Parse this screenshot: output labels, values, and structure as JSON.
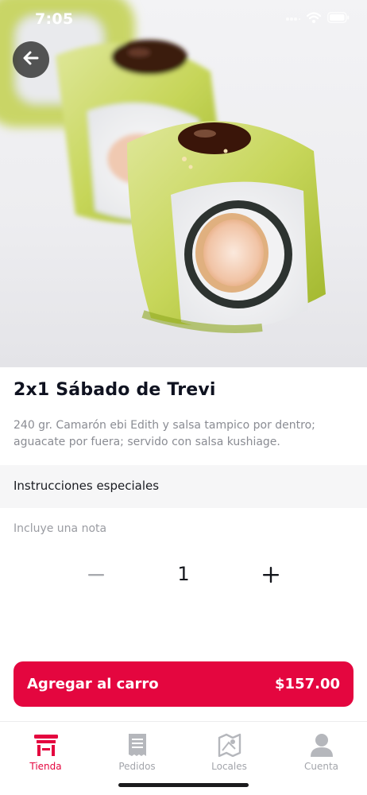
{
  "status_bar": {
    "time": "7:05"
  },
  "header": {
    "back_icon": "arrow-left-icon"
  },
  "product": {
    "image_icon": "sushi-roll-photo",
    "title": "2x1 Sábado de Trevi",
    "description": "240 gr. Camarón ebi Edith y salsa tampico por dentro; aguacate por fuera; servido con salsa kushiage."
  },
  "instructions": {
    "label": "Instrucciones especiales",
    "note_value": "",
    "note_placeholder": "Incluye una nota"
  },
  "quantity": {
    "value": "1",
    "minus_icon": "minus-icon",
    "plus_icon": "plus-icon"
  },
  "cart_button": {
    "label": "Agregar al carro",
    "price": "$157.00"
  },
  "tabs": [
    {
      "label": "Tienda",
      "icon": "store-icon",
      "active": true
    },
    {
      "label": "Pedidos",
      "icon": "receipt-icon",
      "active": false
    },
    {
      "label": "Locales",
      "icon": "map-icon",
      "active": false
    },
    {
      "label": "Cuenta",
      "icon": "user-icon",
      "active": false
    }
  ],
  "colors": {
    "accent": "#e4063f",
    "inactive": "#a3a5ab",
    "text": "#0f1220",
    "muted": "#8a8c93"
  }
}
